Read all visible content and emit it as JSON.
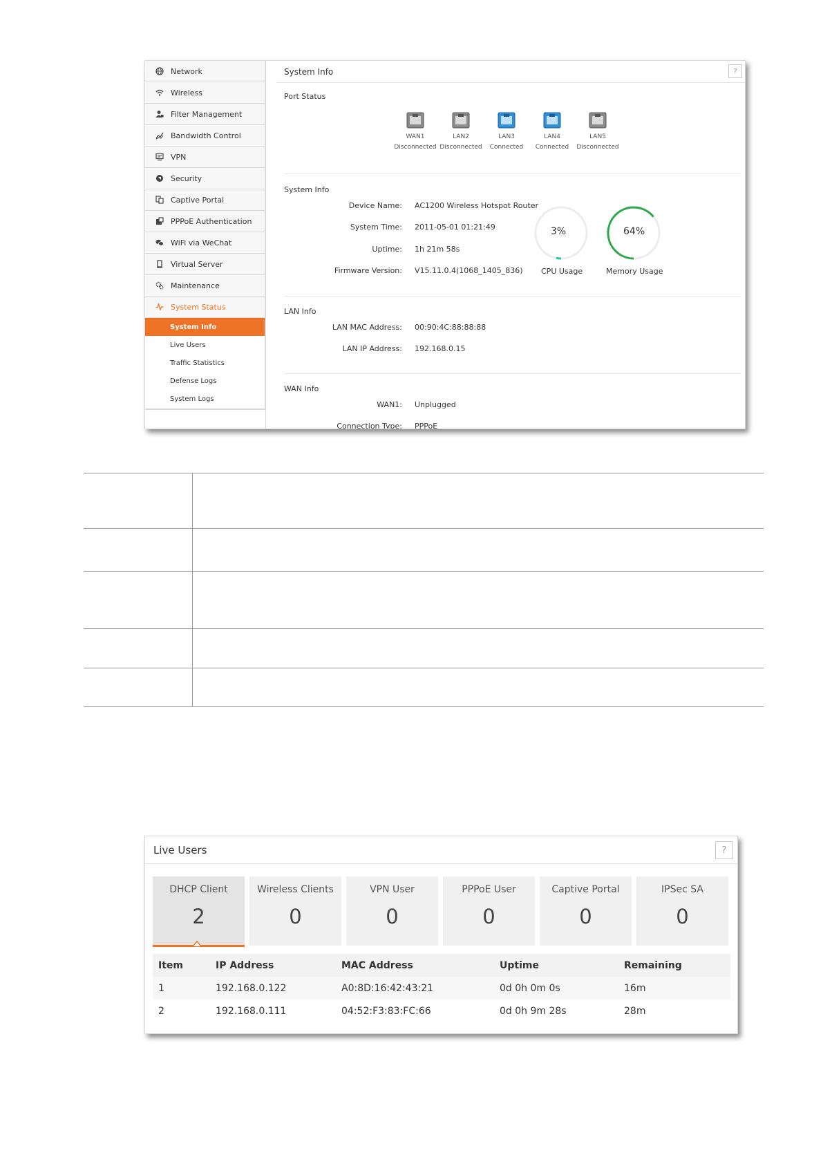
{
  "shot1": {
    "sidebar": {
      "items": [
        {
          "label": "Network",
          "icon": "globe-icon"
        },
        {
          "label": "Wireless",
          "icon": "wifi-icon"
        },
        {
          "label": "Filter Management",
          "icon": "user-filter-icon"
        },
        {
          "label": "Bandwidth Control",
          "icon": "chart-line-icon"
        },
        {
          "label": "VPN",
          "icon": "monitor-icon"
        },
        {
          "label": "Security",
          "icon": "shield-icon"
        },
        {
          "label": "Captive Portal",
          "icon": "portal-icon"
        },
        {
          "label": "PPPoE Authentication",
          "icon": "server-icon"
        },
        {
          "label": "WiFi via WeChat",
          "icon": "chat-icon"
        },
        {
          "label": "Virtual Server",
          "icon": "device-icon"
        },
        {
          "label": "Maintenance",
          "icon": "gear-icon"
        },
        {
          "label": "System Status",
          "icon": "pulse-icon"
        }
      ],
      "subitems": [
        "System Info",
        "Live Users",
        "Traffic Statistics",
        "Defense Logs",
        "System Logs"
      ]
    },
    "header": {
      "title": "System Info",
      "help": "?"
    },
    "port_status": {
      "title": "Port Status",
      "ports": [
        {
          "name": "WAN1",
          "status": "Disconnected",
          "connected": false
        },
        {
          "name": "LAN2",
          "status": "Disconnected",
          "connected": false
        },
        {
          "name": "LAN3",
          "status": "Connected",
          "connected": true
        },
        {
          "name": "LAN4",
          "status": "Connected",
          "connected": true
        },
        {
          "name": "LAN5",
          "status": "Disconnected",
          "connected": false
        }
      ]
    },
    "system_info": {
      "title": "System Info",
      "device_name_label": "Device Name:",
      "device_name": "AC1200 Wireless Hotspot Router",
      "system_time_label": "System Time:",
      "system_time": "2011-05-01 01:21:49",
      "uptime_label": "Uptime:",
      "uptime": "1h 21m 58s",
      "firmware_label": "Firmware Version:",
      "firmware": "V15.11.0.4(1068_1405_836)",
      "cpu_value": "3%",
      "cpu_fraction": 0.03,
      "cpu_label": "CPU Usage",
      "mem_value": "64%",
      "mem_fraction": 0.64,
      "mem_label": "Memory Usage"
    },
    "lan_info": {
      "title": "LAN Info",
      "mac_label": "LAN MAC Address:",
      "mac": "00:90:4C:88:88:88",
      "ip_label": "LAN IP Address:",
      "ip": "192.168.0.15"
    },
    "wan_info": {
      "title": "WAN Info",
      "wan1_label": "WAN1:",
      "wan1": "Unplugged",
      "conn_type_label": "Connection Type:",
      "conn_type": "PPPoE"
    },
    "colors": {
      "accent": "#ef7326",
      "cpu": "#29c4a9",
      "memory": "#2aa84a",
      "port_connected": "#2f8fd8",
      "port_disconnected": "#8a8a8a"
    }
  },
  "shot2": {
    "title": "Live Users",
    "help": "?",
    "tabs": [
      {
        "label": "DHCP Client",
        "count": "2"
      },
      {
        "label": "Wireless Clients",
        "count": "0"
      },
      {
        "label": "VPN User",
        "count": "0"
      },
      {
        "label": "PPPoE User",
        "count": "0"
      },
      {
        "label": "Captive Portal",
        "count": "0"
      },
      {
        "label": "IPSec SA",
        "count": "0"
      }
    ],
    "columns": [
      "Item",
      "IP Address",
      "MAC Address",
      "Uptime",
      "Remaining"
    ],
    "rows": [
      [
        "1",
        "192.168.0.122",
        "A0:8D:16:42:43:21",
        "0d 0h 0m 0s",
        "16m"
      ],
      [
        "2",
        "192.168.0.111",
        "04:52:F3:83:FC:66",
        "0d 0h 9m 28s",
        "28m"
      ]
    ]
  }
}
